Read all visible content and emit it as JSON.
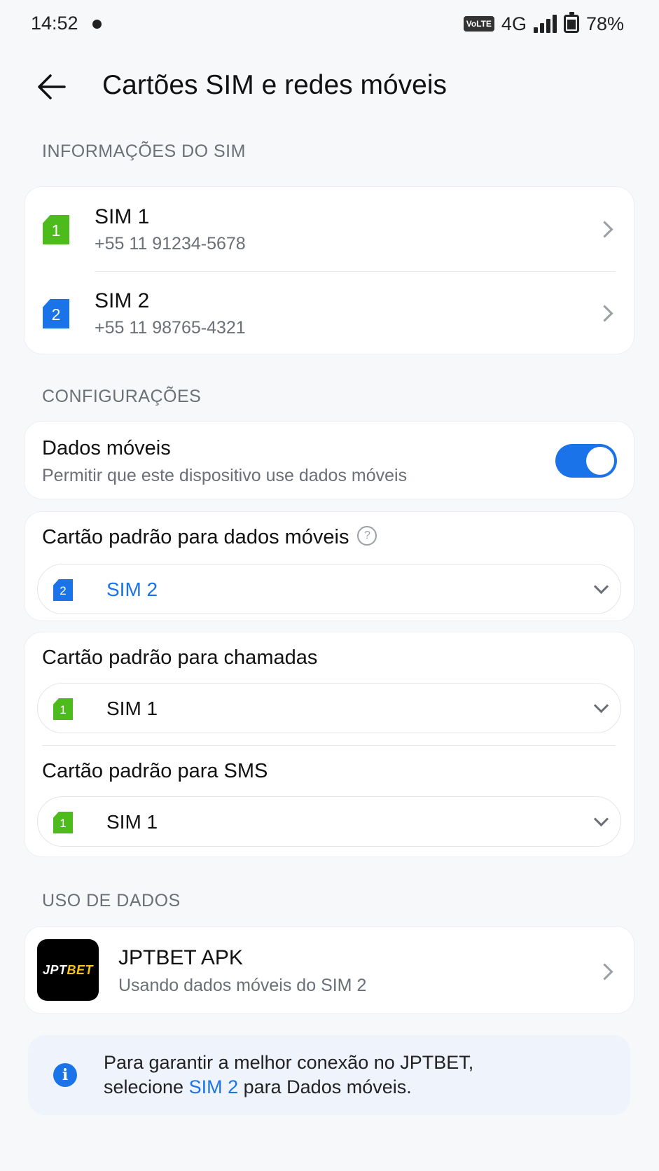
{
  "status_bar": {
    "time": "14:52",
    "volte": "VoLTE",
    "network": "4G",
    "battery": "78%",
    "icons": [
      "notification-dot-icon",
      "volte-icon",
      "signal-icon",
      "battery-icon"
    ]
  },
  "header": {
    "title": "Cartões SIM e redes móveis",
    "back_icon": "arrow-left-icon"
  },
  "sim_info": {
    "section_label": "INFORMAÇÕES DO SIM",
    "sims": [
      {
        "badge": "1",
        "name": "SIM 1",
        "number": "+55 11 91234-5678",
        "color": "#4cbb1b"
      },
      {
        "badge": "2",
        "name": "SIM 2",
        "number": "+55 11 98765-4321",
        "color": "#1a73e8"
      }
    ]
  },
  "settings": {
    "section_label": "CONFIGURAÇÕES",
    "mobile_data": {
      "title": "Dados móveis",
      "subtitle": "Permitir que este dispositivo use dados móveis",
      "enabled": true
    },
    "default_data": {
      "title": "Cartão padrão para dados móveis",
      "help_icon": "?",
      "badge": "2",
      "value": "SIM 2"
    },
    "default_calls": {
      "title": "Cartão padrão para chamadas",
      "badge": "1",
      "value": "SIM 1"
    },
    "default_sms": {
      "title": "Cartão padrão para SMS",
      "badge": "1",
      "value": "SIM 1"
    }
  },
  "data_usage": {
    "section_label": "USO DE DADOS",
    "app": {
      "logo_text_a": "JPT",
      "logo_text_b": "BET",
      "name": "JPTBET APK",
      "subtitle": "Usando dados móveis do SIM 2"
    }
  },
  "info": {
    "icon": "i",
    "line1": "Para garantir a melhor conexão no JPTBET,",
    "line2_a": "selecione ",
    "line2_highlight": "SIM 2",
    "line2_b": " para Dados móveis."
  },
  "colors": {
    "accent": "#1a73e8",
    "sim1_green": "#4cbb1b",
    "background": "#f7f8fa"
  }
}
